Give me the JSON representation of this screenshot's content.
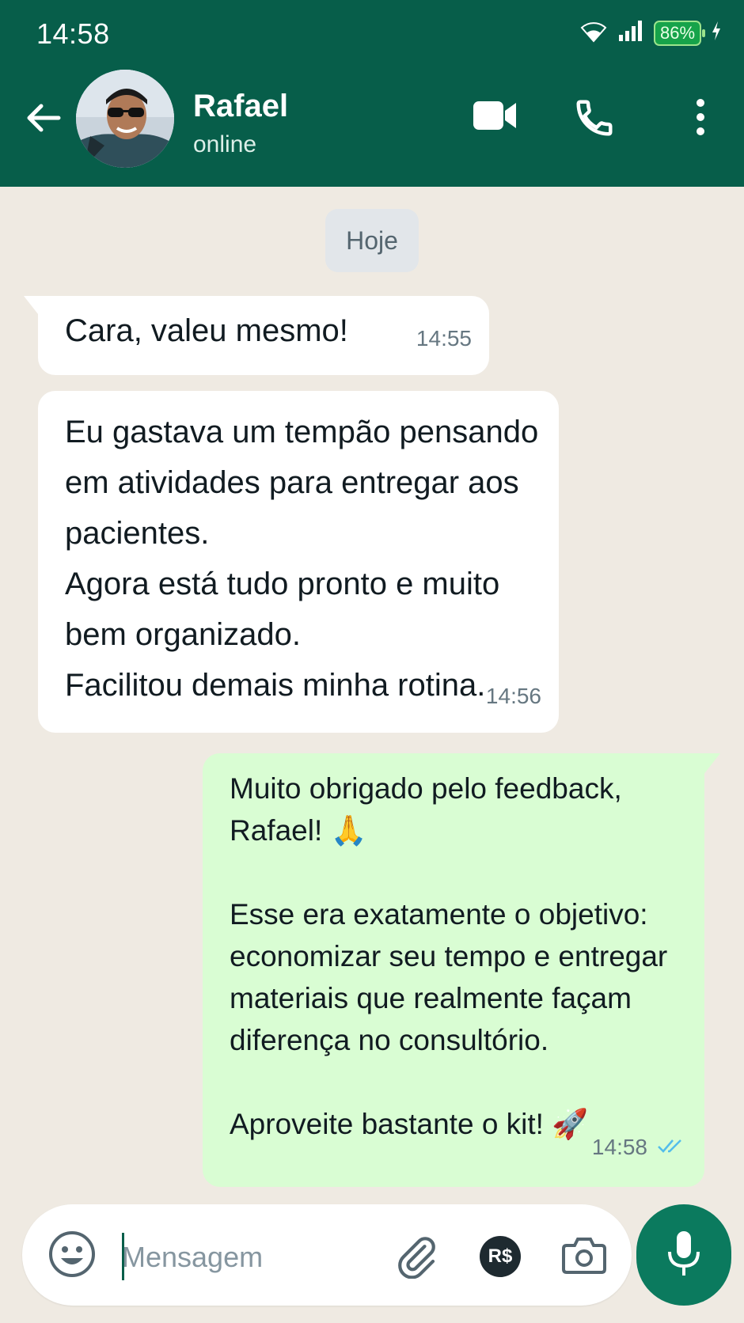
{
  "status_bar": {
    "time": "14:58",
    "battery": "86%"
  },
  "header": {
    "contact_name": "Rafael",
    "contact_status": "online"
  },
  "chat": {
    "date_label": "Hoje",
    "messages": [
      {
        "direction": "in",
        "text": "Cara, valeu mesmo!",
        "time": "14:55"
      },
      {
        "direction": "in",
        "text": "Eu gastava um tempão pensando\nem atividades para entregar aos\npacientes.\nAgora está tudo pronto e muito\nbem organizado.\nFacilitou demais minha rotina.",
        "time": "14:56"
      },
      {
        "direction": "out",
        "text": "Muito obrigado pelo feedback,\nRafael! 🙏\n\nEsse era exatamente o objetivo:\neconomizar seu tempo e entregar\nmateriais que realmente façam\ndiferença no consultório.\n\nAproveite bastante o kit! 🚀",
        "time": "14:58",
        "status": "read"
      }
    ]
  },
  "composer": {
    "placeholder": "Mensagem",
    "value": "",
    "payment_label": "R$"
  },
  "colors": {
    "header": "#075e4a",
    "chat_background": "#efeae2",
    "incoming_bubble": "#ffffff",
    "outgoing_bubble": "#d9fdd3",
    "read_ticks": "#53bdeb",
    "mic_button": "#0b7a5e"
  },
  "icons": [
    "back-arrow-icon",
    "video-call-icon",
    "phone-icon",
    "more-options-icon",
    "emoji-icon",
    "attach-icon",
    "payment-icon",
    "camera-icon",
    "mic-icon",
    "wifi-icon",
    "signal-icon",
    "battery-icon",
    "charging-icon",
    "double-check-icon"
  ]
}
